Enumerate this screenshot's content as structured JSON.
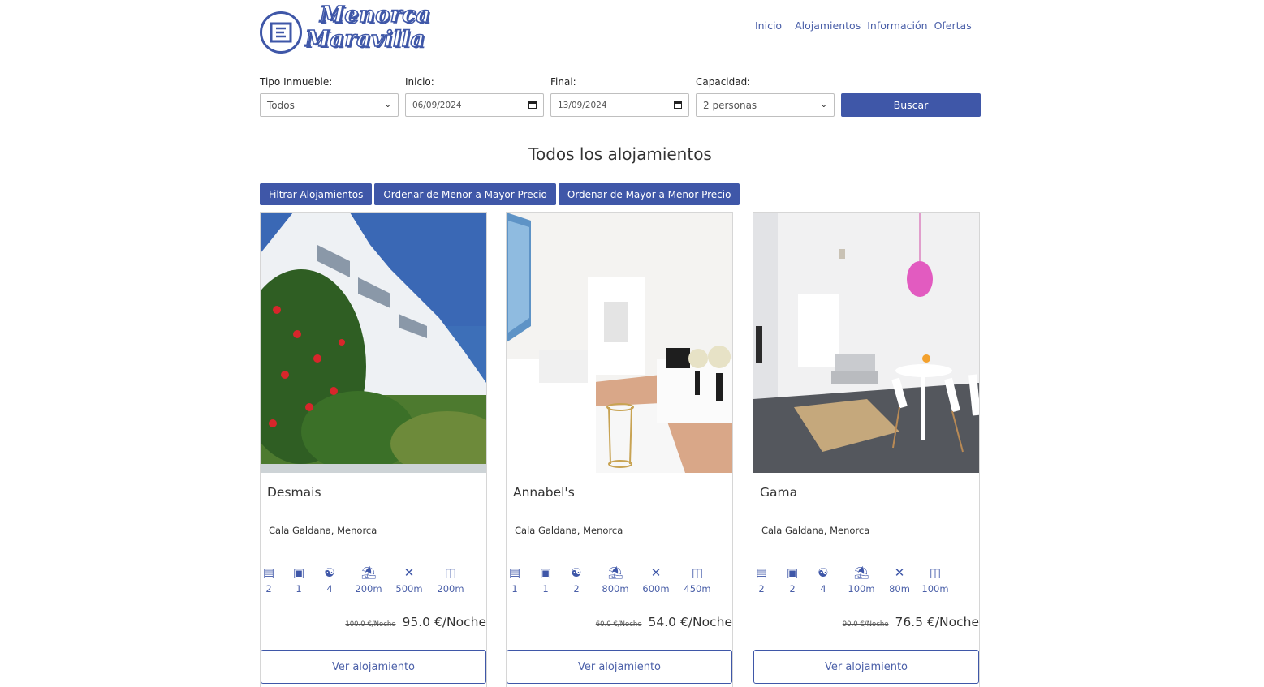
{
  "brand": {
    "line1": "Menorca",
    "line2": "Maravilla"
  },
  "nav": [
    "Inicio",
    "Alojamientos",
    "Información",
    "Ofertas"
  ],
  "search": {
    "tipo_label": "Tipo Inmueble:",
    "tipo_value": "Todos",
    "inicio_label": "Inicio:",
    "inicio_value": "06/09/2024",
    "final_label": "Final:",
    "final_value": "13/09/2024",
    "capacidad_label": "Capacidad:",
    "capacidad_value": "2 personas",
    "button": "Buscar"
  },
  "section_title": "Todos los alojamientos",
  "filters": [
    "Filtrar Alojamientos",
    "Ordenar de Menor a Mayor Precio",
    "Ordenar de Mayor a Menor Precio"
  ],
  "cards": [
    {
      "title": "Desmais",
      "location": "Cala Galdana, Menorca",
      "amenities": [
        "2",
        "1",
        "4",
        "200m",
        "500m",
        "200m"
      ],
      "old_price": "100.0 €/Noche",
      "price": "95.0 €/Noche",
      "button": "Ver alojamiento"
    },
    {
      "title": "Annabel's",
      "location": "Cala Galdana, Menorca",
      "amenities": [
        "1",
        "1",
        "2",
        "800m",
        "600m",
        "450m"
      ],
      "old_price": "60.0 €/Noche",
      "price": "54.0 €/Noche",
      "button": "Ver alojamiento"
    },
    {
      "title": "Gama",
      "location": "Cala Galdana, Menorca",
      "amenities": [
        "2",
        "2",
        "4",
        "100m",
        "80m",
        "100m"
      ],
      "old_price": "90.0 €/Noche",
      "price": "76.5 €/Noche",
      "button": "Ver alojamiento"
    }
  ],
  "amenity_icons": [
    "bed-icon",
    "bath-icon",
    "guests-icon",
    "beach-icon",
    "restaurant-icon",
    "shop-icon"
  ],
  "colors": {
    "accent": "#3f57a8"
  }
}
